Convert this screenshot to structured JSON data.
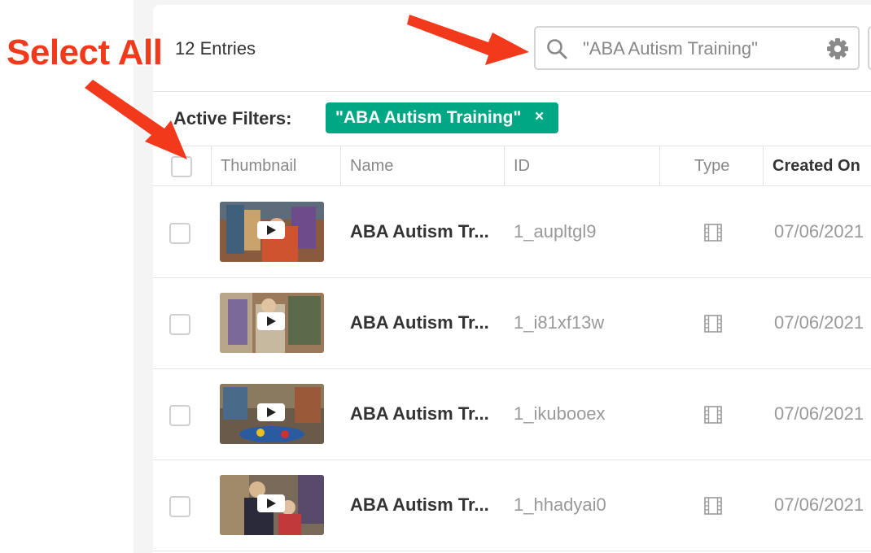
{
  "callout": {
    "label": "Select All"
  },
  "header": {
    "entries_count": "12 Entries"
  },
  "search": {
    "value": "\"ABA Autism Training\"",
    "icon": "search-icon",
    "settings_icon": "gear-icon"
  },
  "filters": {
    "label": "Active Filters:",
    "tags": [
      {
        "label": "\"ABA Autism Training\"",
        "close": "×"
      }
    ]
  },
  "table": {
    "columns": [
      "Thumbnail",
      "Name",
      "ID",
      "Type",
      "Created On"
    ],
    "rows": [
      {
        "name": "ABA Autism Tr...",
        "id": "1_aupltgl9",
        "type": "video",
        "created": "07/06/2021"
      },
      {
        "name": "ABA Autism Tr...",
        "id": "1_i81xf13w",
        "type": "video",
        "created": "07/06/2021"
      },
      {
        "name": "ABA Autism Tr...",
        "id": "1_ikubooex",
        "type": "video",
        "created": "07/06/2021"
      },
      {
        "name": "ABA Autism Tr...",
        "id": "1_hhadyai0",
        "type": "video",
        "created": "07/06/2021"
      }
    ]
  },
  "colors": {
    "accent": "#00a784",
    "annotation": "#f2391c"
  }
}
